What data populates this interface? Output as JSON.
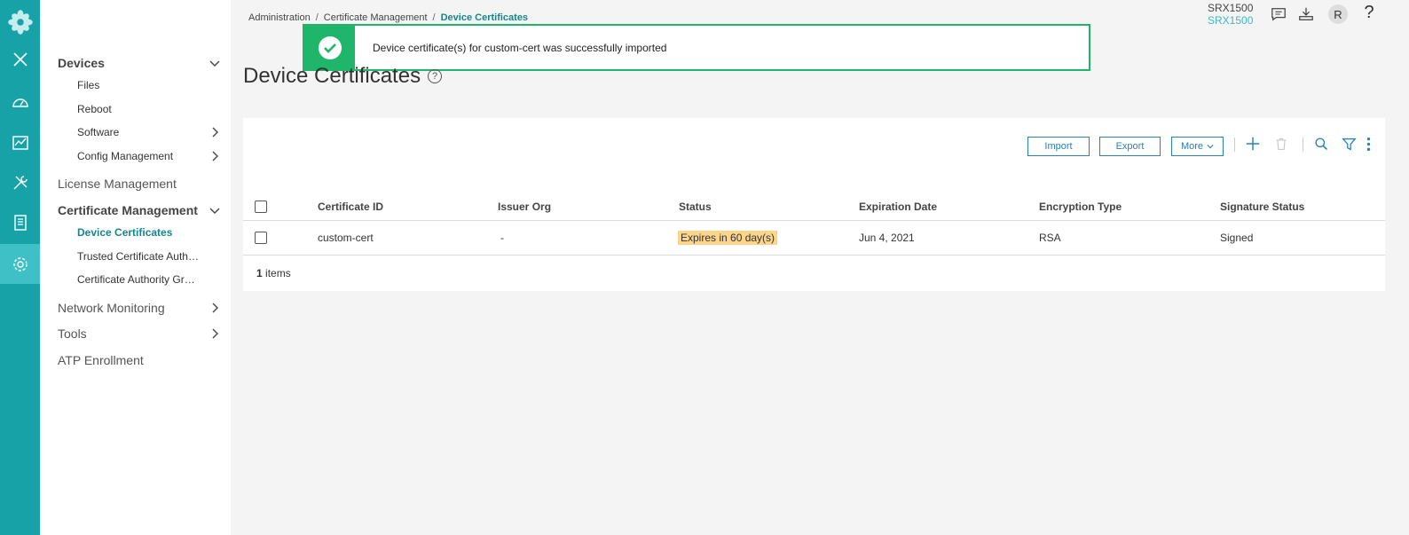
{
  "breadcrumb": {
    "items": [
      "Administration",
      "Certificate Management"
    ],
    "separator": "/",
    "current": "Device Certificates"
  },
  "header": {
    "device_model": "SRX1500",
    "device_host": "SRX1500",
    "user_initial": "R",
    "help_glyph": "?"
  },
  "toast": {
    "message": "Device certificate(s) for custom-cert was successfully imported",
    "status_color": "#1fb56a"
  },
  "page": {
    "title": "Device Certificates",
    "help_glyph": "?"
  },
  "nav": {
    "devices": "Devices",
    "files": "Files",
    "reboot": "Reboot",
    "software": "Software",
    "config_management": "Config Management",
    "license_management": "License Management",
    "certificate_management": "Certificate Management",
    "device_certificates": "Device Certificates",
    "trusted_ca": "Trusted Certificate Authorities",
    "ca_group": "Certificate Authority Group",
    "network_monitoring": "Network Monitoring",
    "tools": "Tools",
    "atp_enrollment": "ATP Enrollment"
  },
  "rail": {
    "icons": [
      "logo-icon",
      "close-icon",
      "dashboard-icon",
      "monitor-icon",
      "configure-icon",
      "reports-icon",
      "settings-icon"
    ],
    "color": "#17a2a8",
    "active_color": "#3fc0c6"
  },
  "toolbar": {
    "import": "Import",
    "export": "Export",
    "more": "More"
  },
  "table": {
    "columns": [
      "Certificate ID",
      "Issuer Org",
      "Status",
      "Expiration Date",
      "Encryption Type",
      "Signature Status"
    ],
    "rows": [
      {
        "certificate_id": "custom-cert",
        "issuer_org": "-",
        "status": "Expires in 60 day(s)",
        "expiration_date": "Jun 4, 2021",
        "encryption_type": "RSA",
        "signature_status": "Signed"
      }
    ],
    "footer_count": "1",
    "footer_label": "items",
    "status_badge_color": "#fbd58c"
  }
}
